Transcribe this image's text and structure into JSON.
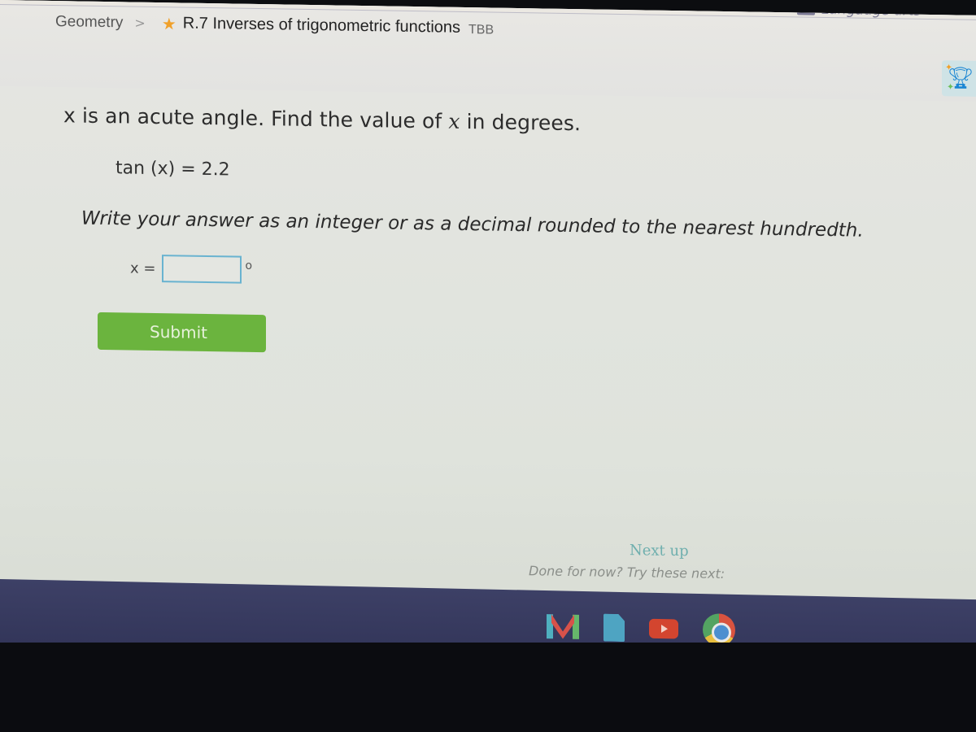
{
  "subject_bar": {
    "active_tab_color": "#1f8bd0",
    "tab_label": "Language arts",
    "tab_icon": "book-icon"
  },
  "breadcrumb": {
    "course": "Geometry",
    "separator": ">",
    "skill_icon": "star-icon",
    "skill": "R.7 Inverses of trigonometric functions",
    "code": "TBB"
  },
  "award": {
    "icon": "trophy-icon",
    "color": "#1b86d3"
  },
  "problem": {
    "prompt_prefix": "x is an acute angle. Find the value of ",
    "prompt_var": "x",
    "prompt_suffix": " in degrees.",
    "equation": "tan (x)  =  2.2",
    "instruction": "Write your answer as an integer or as a decimal rounded to the nearest hundredth.",
    "answer_label": "x  =",
    "answer_value": "",
    "answer_unit": "o"
  },
  "actions": {
    "submit_label": "Submit",
    "submit_color": "#6bb43e"
  },
  "next_up": {
    "title": "Next up",
    "subtitle": "Done for now? Try these next:"
  },
  "shelf": {
    "apps": [
      "gmail-icon",
      "docs-icon",
      "youtube-icon",
      "chrome-icon"
    ]
  }
}
